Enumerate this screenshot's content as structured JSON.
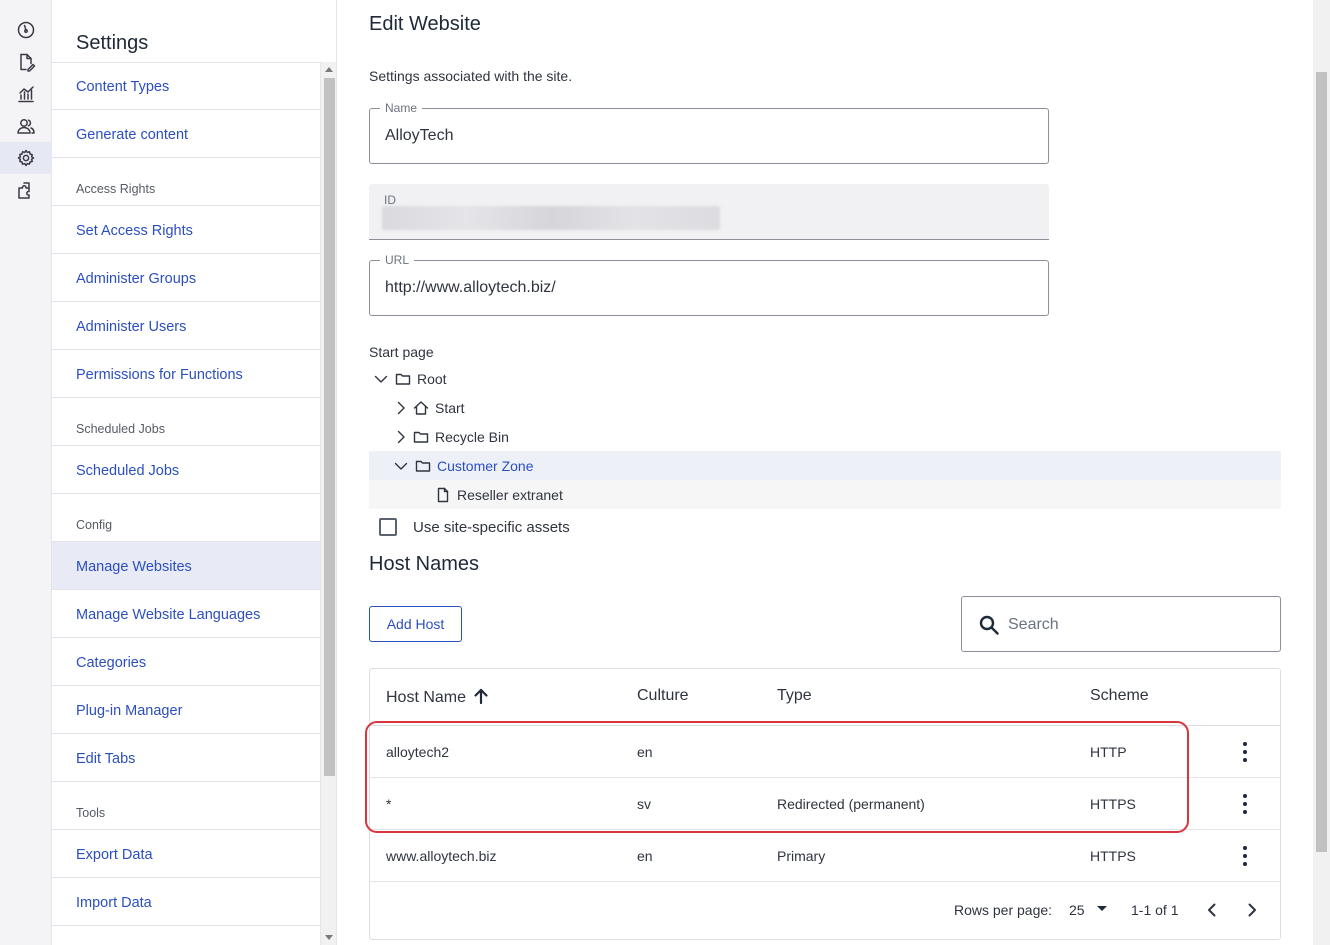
{
  "nav": {
    "title": "Settings",
    "items": [
      {
        "type": "link",
        "label": "Content Types"
      },
      {
        "type": "link",
        "label": "Generate content"
      },
      {
        "type": "group",
        "label": "Access Rights"
      },
      {
        "type": "link",
        "label": "Set Access Rights"
      },
      {
        "type": "link",
        "label": "Administer Groups"
      },
      {
        "type": "link",
        "label": "Administer Users"
      },
      {
        "type": "link",
        "label": "Permissions for Functions"
      },
      {
        "type": "group",
        "label": "Scheduled Jobs"
      },
      {
        "type": "link",
        "label": "Scheduled Jobs"
      },
      {
        "type": "group",
        "label": "Config"
      },
      {
        "type": "link",
        "label": "Manage Websites",
        "active": true
      },
      {
        "type": "link",
        "label": "Manage Website Languages"
      },
      {
        "type": "link",
        "label": "Categories"
      },
      {
        "type": "link",
        "label": "Plug-in Manager"
      },
      {
        "type": "link",
        "label": "Edit Tabs"
      },
      {
        "type": "group",
        "label": "Tools"
      },
      {
        "type": "link",
        "label": "Export Data"
      },
      {
        "type": "link",
        "label": "Import Data"
      }
    ]
  },
  "main": {
    "title": "Edit Website",
    "subtitle": "Settings associated with the site.",
    "name_field": {
      "label": "Name",
      "value": "AlloyTech"
    },
    "id_field": {
      "label": "ID"
    },
    "url_field": {
      "label": "URL",
      "value": "http://www.alloytech.biz/"
    },
    "start_page": {
      "label": "Start page",
      "root": "Root",
      "start": "Start",
      "recycle_bin": "Recycle Bin",
      "customer_zone": "Customer Zone",
      "reseller_extranet": "Reseller extranet"
    },
    "site_assets_label": "Use site-specific assets",
    "host_names": {
      "title": "Host Names",
      "add_label": "Add Host",
      "search_placeholder": "Search",
      "columns": {
        "host": "Host Name",
        "culture": "Culture",
        "type": "Type",
        "scheme": "Scheme"
      },
      "rows": [
        {
          "host": "alloytech2",
          "culture": "en",
          "type": "",
          "scheme": "HTTP"
        },
        {
          "host": "*",
          "culture": "sv",
          "type": "Redirected (permanent)",
          "scheme": "HTTPS"
        },
        {
          "host": "www.alloytech.biz",
          "culture": "en",
          "type": "Primary",
          "scheme": "HTTPS"
        }
      ],
      "pager": {
        "rows_per_page_label": "Rows per page:",
        "rows_per_page": "25",
        "range": "1-1 of 1"
      }
    }
  },
  "colors": {
    "accent": "#2c4fbf",
    "highlight": "#d9353f"
  }
}
